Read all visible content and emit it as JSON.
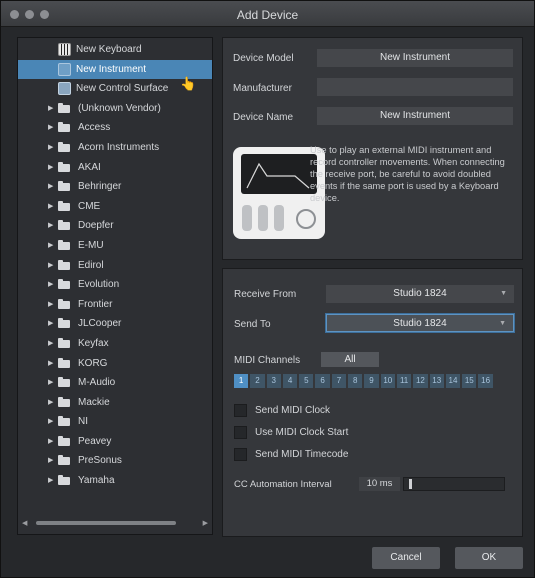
{
  "window": {
    "title": "Add Device"
  },
  "device_list": {
    "special_items": [
      {
        "label": "New Keyboard",
        "icon": "keyboard-icon"
      },
      {
        "label": "New Instrument",
        "icon": "instrument-icon",
        "selected": true
      },
      {
        "label": "New Control Surface",
        "icon": "control-surface-icon"
      }
    ],
    "vendors": [
      "(Unknown Vendor)",
      "Access",
      "Acorn Instruments",
      "AKAI",
      "Behringer",
      "CME",
      "Doepfer",
      "E-MU",
      "Edirol",
      "Evolution",
      "Frontier",
      "JLCooper",
      "Keyfax",
      "KORG",
      "M-Audio",
      "Mackie",
      "NI",
      "Peavey",
      "PreSonus",
      "Yamaha"
    ]
  },
  "device_info": {
    "model_label": "Device Model",
    "model_value": "New Instrument",
    "manufacturer_label": "Manufacturer",
    "manufacturer_value": "",
    "name_label": "Device Name",
    "name_value": "New Instrument",
    "description": "Use to play an external MIDI instrument and record controller movements. When connecting the receive port, be careful to avoid doubled events if the same port is used by a Keyboard device."
  },
  "routing": {
    "receive_label": "Receive From",
    "receive_value": "Studio 1824",
    "send_label": "Send To",
    "send_value": "Studio 1824",
    "midi_channels_label": "MIDI Channels",
    "all_label": "All",
    "channels": [
      "1",
      "2",
      "3",
      "4",
      "5",
      "6",
      "7",
      "8",
      "9",
      "10",
      "11",
      "12",
      "13",
      "14",
      "15",
      "16"
    ],
    "active_channel": "1"
  },
  "options": {
    "send_clock": "Send MIDI Clock",
    "use_clock_start": "Use MIDI Clock Start",
    "send_timecode": "Send MIDI Timecode",
    "cc_interval_label": "CC Automation Interval",
    "cc_interval_value": "10 ms"
  },
  "buttons": {
    "cancel": "Cancel",
    "ok": "OK"
  },
  "colors": {
    "selection": "#4a86b6",
    "active_channel": "#4f8fc4",
    "focus_border": "#5e93c1"
  }
}
